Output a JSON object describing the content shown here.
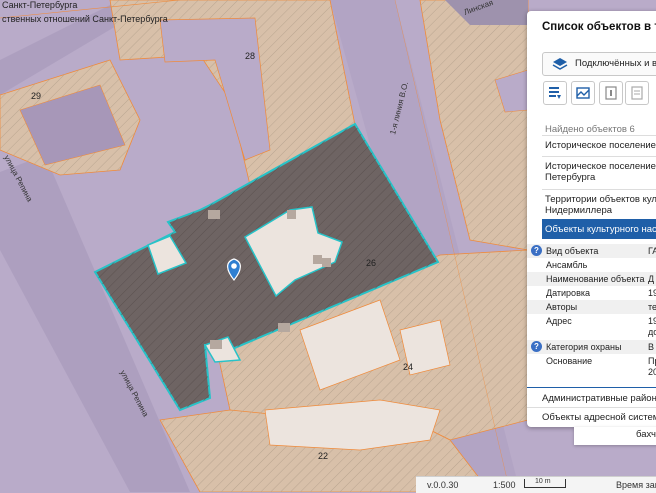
{
  "map": {
    "attribution": {
      "line1": "Санкт-Петербурга",
      "line2": "ственных отношений Санкт-Петербурга"
    },
    "street_corner_label": "Линская",
    "building_numbers": {
      "b28": "28",
      "b29": "29",
      "b26": "26",
      "b24": "24",
      "b22": "22"
    },
    "streets": {
      "line_1": "1-я линия В.О.",
      "repina_top": "улица Репина",
      "repina_bottom": "улица Репина"
    },
    "colors": {
      "zone_fill": "#b9abc9",
      "parcel_fill": "#d8c0a9",
      "selected_fill": "#6e6463",
      "selected_outline": "#27c3c8",
      "parcel_outline": "#f08a3a",
      "marker": "#2f7fd1"
    }
  },
  "panel": {
    "title": "Список объектов в точке",
    "layers_button": "Подключённых и ви",
    "tool_icons": [
      "list-icon",
      "map-icon",
      "frame-icon",
      "document-icon"
    ],
    "found_count_text": "Найдено объектов 6",
    "results": [
      {
        "label_1": "Историческое поселение. С",
        "active": false
      },
      {
        "label_1": "Историческое поселение. Гр",
        "label_2": "Петербурга",
        "active": false
      },
      {
        "label_1": "Территории объектов культ",
        "label_2": "Нидермиллера",
        "active": false
      },
      {
        "label_1": "Объекты культурного насле",
        "active": true
      }
    ],
    "attributes": [
      {
        "key": "Вид объекта",
        "value": "ГА",
        "info": true
      },
      {
        "key": "Ансамбль",
        "value": ""
      },
      {
        "key": "Наименование объекта",
        "value": "Д"
      },
      {
        "key": "Датировка",
        "value": "19"
      },
      {
        "key": "Авторы",
        "value": "те"
      },
      {
        "key": "Адрес",
        "value": "19",
        "value_2": "до"
      },
      {
        "key": "Категория охраны",
        "value": "В",
        "info": true
      },
      {
        "key": "Основание",
        "value": "Пр",
        "value_2": "20"
      }
    ],
    "bottom_results": [
      "Административные район",
      "Объекты адресной систем"
    ]
  },
  "tooltip": {
    "text": "бахч"
  },
  "statusbar": {
    "version": "v.0.0.30",
    "scale": "1:500",
    "scale_bar_label": "10 m",
    "load_time": "Время загр"
  }
}
